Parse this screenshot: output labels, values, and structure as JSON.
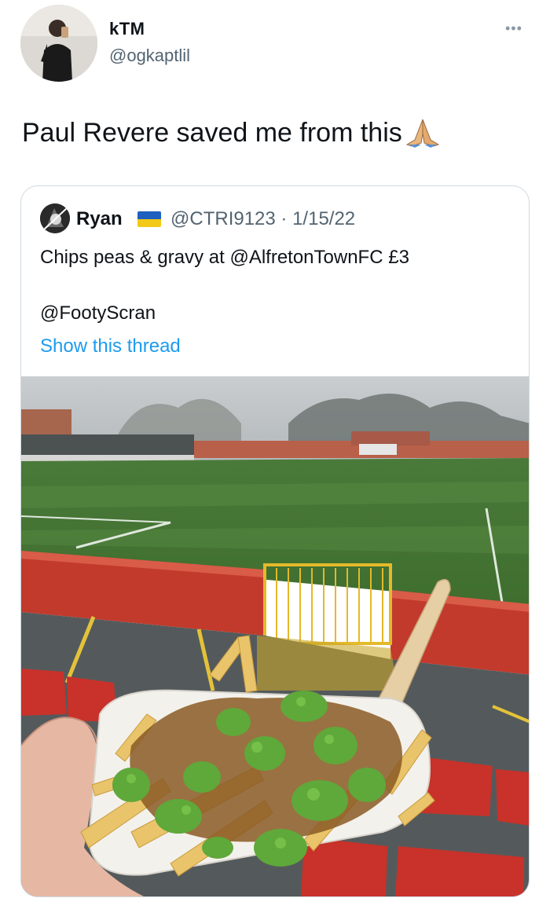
{
  "tweet": {
    "author_name": "kTM",
    "author_handle": "@ogkaptlil",
    "more_glyph": "•••",
    "text": "Paul Revere saved me from this",
    "emoji": "folded-hands-emoji"
  },
  "quoted_tweet": {
    "author_name": "Ryan",
    "flag": "ukraine-flag",
    "handle_date": "@CTRI9123 · 1/15/22",
    "text": "Chips peas & gravy at @AlfretonTownFC £3",
    "mention": "@FootyScran",
    "show_thread": "Show this thread",
    "photo": "photo of chips with mushy peas and gravy held over a football pitch"
  },
  "colors": {
    "text": "#0f1419",
    "secondary": "#536471",
    "link": "#1d9bf0",
    "border": "#cfd9de"
  }
}
